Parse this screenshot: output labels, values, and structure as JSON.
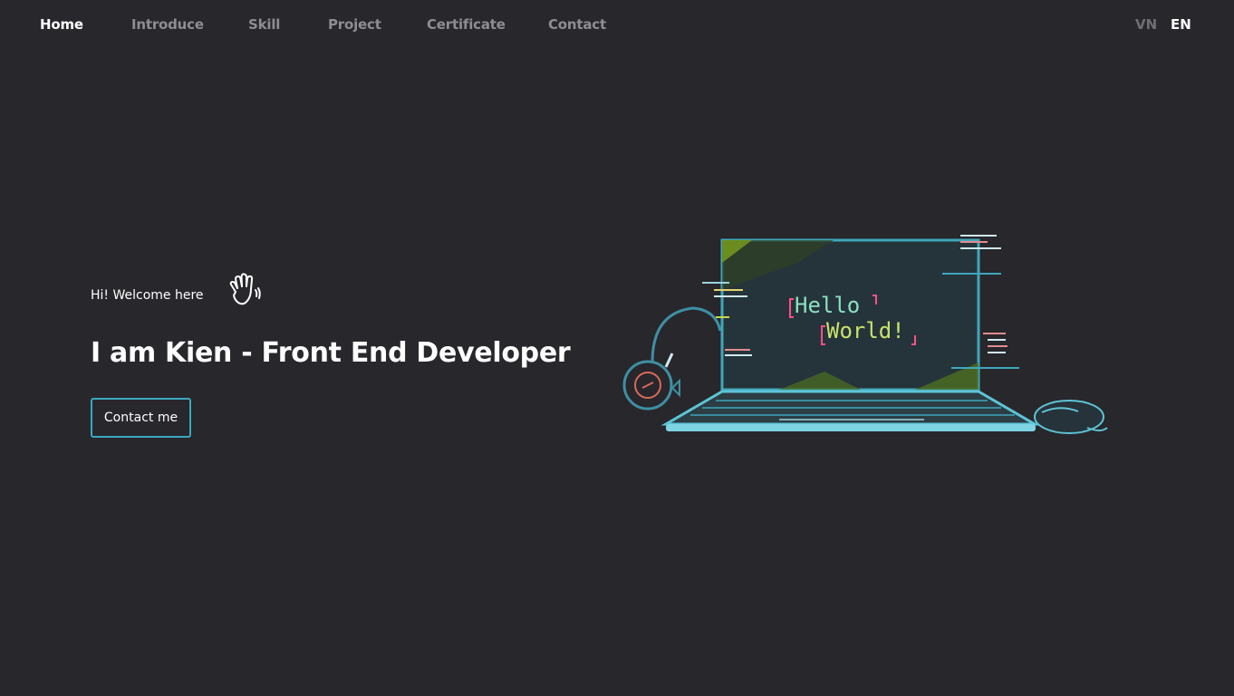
{
  "nav": {
    "items": [
      {
        "label": "Home",
        "active": true
      },
      {
        "label": "Introduce",
        "active": false
      },
      {
        "label": "Skill",
        "active": false
      },
      {
        "label": "Project",
        "active": false
      },
      {
        "label": "Certificate",
        "active": false
      },
      {
        "label": "Contact",
        "active": false
      }
    ],
    "languages": [
      {
        "label": "VN",
        "active": false
      },
      {
        "label": "EN",
        "active": true
      }
    ]
  },
  "hero": {
    "greeting": "Hi! Welcome here",
    "greeting_icon": "waving-hand-icon",
    "headline": "I am Kien - Front End Developer",
    "cta_label": "Contact me"
  },
  "illustration": {
    "screen_text_line1": "Hello",
    "screen_text_line2": "World!"
  },
  "colors": {
    "background": "#27272c",
    "accent": "#3aa8bf",
    "text": "#ffffff",
    "nav_inactive": "#8d8d93"
  }
}
